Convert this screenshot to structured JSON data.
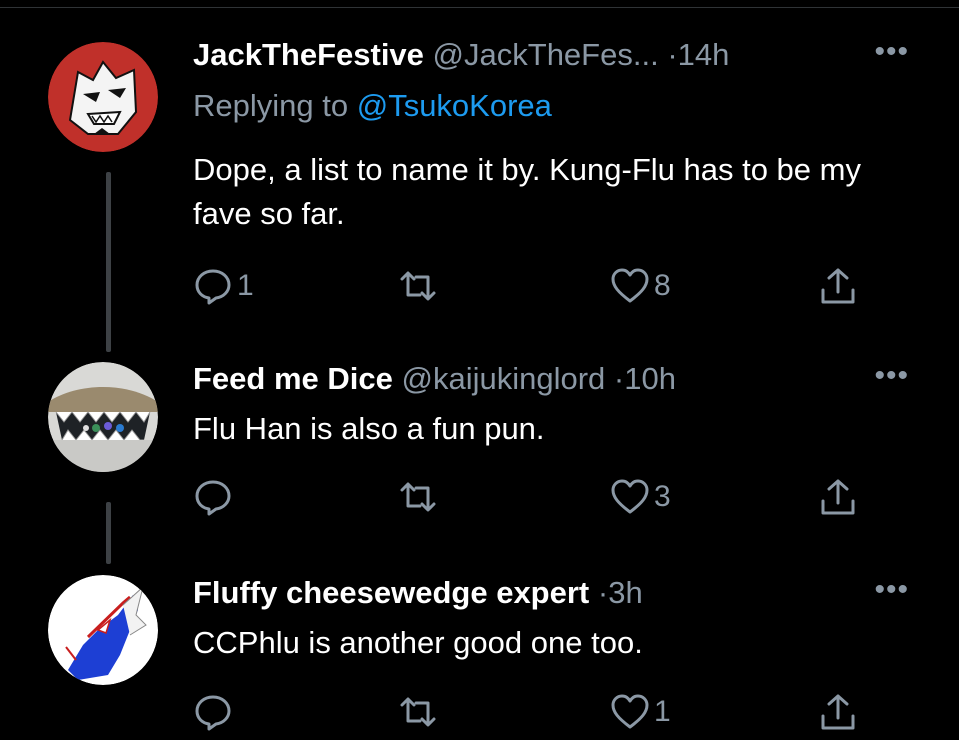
{
  "tweets": [
    {
      "name": "JackTheFestive",
      "handle": "@JackTheFes...",
      "dot": "·",
      "time": "14h",
      "more": "•••",
      "replying_prefix": "Replying to ",
      "replying_to": "@TsukoKorea",
      "text": "Dope, a list to name it by. Kung-Flu has to be my fave so far.",
      "replies": "1",
      "retweets": "",
      "likes": "8"
    },
    {
      "name": "Feed me Dice",
      "handle": "@kaijukinglord",
      "dot": "·",
      "time": "10h",
      "more": "•••",
      "text": "Flu Han is also a fun pun.",
      "replies": "",
      "retweets": "",
      "likes": "3"
    },
    {
      "name": "Fluffy cheesewedge expert",
      "handle": "",
      "dot": "·",
      "time": "3h",
      "more": "•••",
      "text": "CCPhlu is another good one too.",
      "replies": "",
      "retweets": "",
      "likes": "1"
    }
  ],
  "icons": {
    "reply": "reply-icon",
    "retweet": "retweet-icon",
    "like": "like-icon",
    "share": "share-icon"
  },
  "colors": {
    "background": "#000000",
    "secondary_text": "#8b98a5",
    "link": "#1d9bf0",
    "thread_line": "#3d4145"
  }
}
